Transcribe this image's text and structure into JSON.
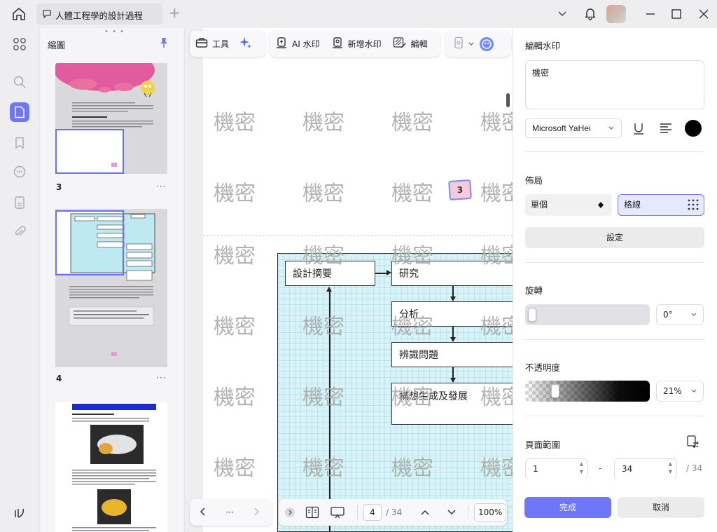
{
  "titlebar": {
    "tab_title": "人體工程學的設計過程",
    "add_tab": "+"
  },
  "thumbnails": {
    "panel_title": "縮圖",
    "pages": [
      {
        "number": "3",
        "more": "···"
      },
      {
        "number": "4",
        "more": "···"
      }
    ]
  },
  "toolbar": {
    "tools_label": "工具",
    "ai_watermark_label": "AI 水印",
    "add_watermark_label": "新增水印",
    "edit_label": "編輯"
  },
  "document": {
    "watermark_text": "機密",
    "page_badge": "3",
    "flow": {
      "design_summary": "設計摘要",
      "research": "研究",
      "analysis": "分析",
      "identify_problem": "辨識問題",
      "develop": "構想生成及發展"
    }
  },
  "bottom_nav": {
    "more": "···",
    "current_page": "4",
    "total_pages": "/ 34",
    "zoom": "100%"
  },
  "watermark_panel": {
    "title": "編輯水印",
    "text_value": "機密",
    "font": "Microsoft YaHei",
    "color": "#000000",
    "layout_title": "佈局",
    "layout_single": "單個",
    "layout_grid": "格線",
    "settings_button": "設定",
    "rotation_title": "旋轉",
    "rotation_value": "0°",
    "rotation_level": 0,
    "opacity_title": "不透明度",
    "opacity_value": "21%",
    "opacity_level": 0.21,
    "page_range_title": "頁面範圍",
    "range_from": "1",
    "range_dash": "-",
    "range_to": "34",
    "range_total": "/ 34",
    "done_button": "完成",
    "cancel_button": "取消"
  },
  "colors": {
    "accent": "#6f76f7",
    "grid_selected_bg": "#e6e8ff"
  }
}
